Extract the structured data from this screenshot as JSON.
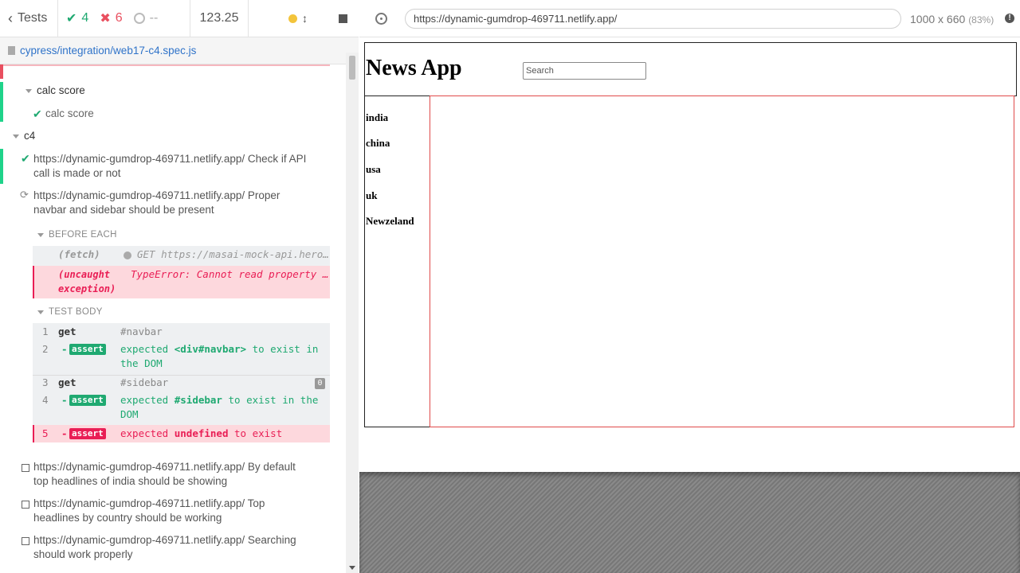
{
  "reporter": {
    "header": {
      "tests_label": "Tests",
      "passed": "4",
      "failed": "6",
      "pending": "--",
      "duration": "123.25"
    },
    "spec_file": "cypress/integration/web17-c4.spec.js",
    "suites": [
      {
        "label": "calc score"
      },
      {
        "label": "calc score"
      },
      {
        "label": "c4"
      }
    ],
    "tests": {
      "t1_line1": "https://dynamic-gumdrop-469711.netlify.app/ Check if API",
      "t1_line2": "call is made or not",
      "t2_line1": "https://dynamic-gumdrop-469711.netlify.app/ Proper",
      "t2_line2": "navbar and sidebar should be present",
      "t3_line1": "https://dynamic-gumdrop-469711.netlify.app/ By default",
      "t3_line2": "top headlines of india should be showing",
      "t4_line1": "https://dynamic-gumdrop-469711.netlify.app/ Top",
      "t4_line2": "headlines by country should be working",
      "t5_line1": "https://dynamic-gumdrop-469711.netlify.app/ Searching",
      "t5_line2": "should work properly"
    },
    "before_each": {
      "label": "BEFORE EACH",
      "fetch_name": "(fetch)",
      "fetch_msg": "GET https://masai-mock-api.hero…",
      "exc_name_1": "(uncaught",
      "exc_name_2": "exception)",
      "exc_msg": "TypeError: Cannot read property …"
    },
    "test_body": {
      "label": "TEST BODY",
      "c1_num": "1",
      "c1_name": "get",
      "c1_msg": "#navbar",
      "c2_num": "2",
      "c2_badge": "assert",
      "c2_msg_a": "expected",
      "c2_msg_b": "<div#navbar>",
      "c2_msg_c": "to exist in",
      "c2_msg_d": "the DOM",
      "c3_num": "3",
      "c3_name": "get",
      "c3_msg": "#sidebar",
      "c3_count": "0",
      "c4_num": "4",
      "c4_badge": "assert",
      "c4_msg_a": "expected",
      "c4_msg_b": "#sidebar",
      "c4_msg_c": "to exist in the",
      "c4_msg_d": "DOM",
      "c5_num": "5",
      "c5_badge": "assert",
      "c5_msg_a": "expected",
      "c5_msg_b": "undefined",
      "c5_msg_c": "to exist"
    }
  },
  "aut": {
    "url": "https://dynamic-gumdrop-469711.netlify.app/",
    "viewport": "1000 x 660",
    "scale": "(83%)",
    "app": {
      "title": "News App",
      "search_placeholder": "Search",
      "countries": [
        "india",
        "china",
        "usa",
        "uk",
        "Newzeland"
      ]
    }
  },
  "colors": {
    "pass": "#1fa971",
    "fail": "#e94f5f",
    "link": "#2f73c9"
  }
}
